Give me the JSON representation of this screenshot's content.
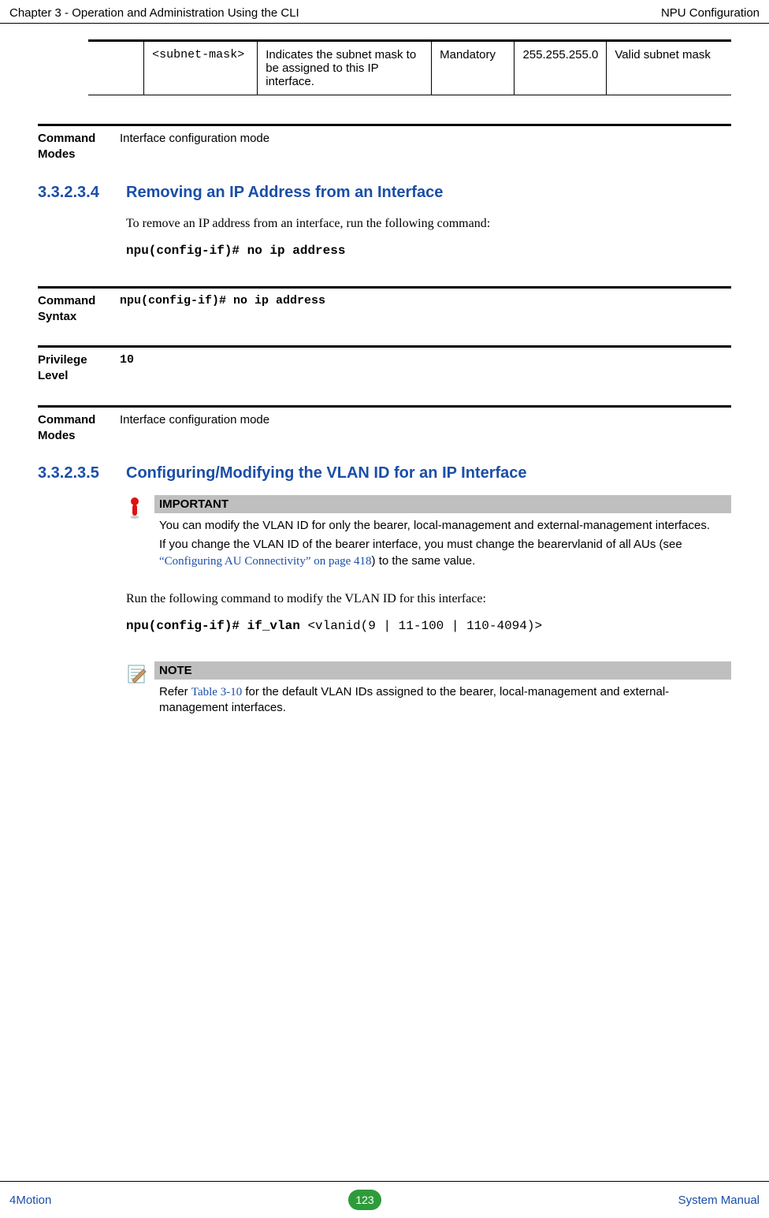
{
  "header": {
    "left": "Chapter 3 - Operation and Administration Using the CLI",
    "right": "NPU Configuration"
  },
  "param_table": {
    "cells": {
      "p0": "<subnet-mask>",
      "p1": "Indicates the subnet mask to be assigned to this IP interface.",
      "p2": "Mandatory",
      "p3": "255.255.255.0",
      "p4": "Valid subnet mask"
    }
  },
  "def1": {
    "label": "Command Modes",
    "value": "Interface configuration mode"
  },
  "sec1": {
    "num": "3.3.2.3.4",
    "title": "Removing an IP Address from an Interface",
    "body": "To remove an IP address from an interface, run the following command:",
    "cmd": "npu(config-if)# no ip address"
  },
  "def2": {
    "label": "Command Syntax",
    "value": "npu(config-if)# no ip address"
  },
  "def3": {
    "label": "Privilege Level",
    "value": "10"
  },
  "def4": {
    "label": "Command Modes",
    "value": "Interface configuration mode"
  },
  "sec2": {
    "num": "3.3.2.3.5",
    "title": "Configuring/Modifying the VLAN ID for an IP Interface"
  },
  "important": {
    "head": "IMPORTANT",
    "text1": "You can modify the VLAN ID for only the bearer, local-management and external-management interfaces.",
    "text2a": "If you change the VLAN ID of the bearer interface, you must change the bearervlanid of all AUs (see ",
    "text2link": "“Configuring AU Connectivity” on page 418",
    "text2b": ") to the same value."
  },
  "runtext": "Run the following command to modify the VLAN ID for this interface:",
  "cmd2a": "npu(config-if)# if_vlan ",
  "cmd2b": "<vlanid(9 | 11-100 | 110-4094)>",
  "note": {
    "head": "NOTE",
    "text_a": "Refer ",
    "text_link": "Table 3-10",
    "text_b": " for the default VLAN IDs assigned to the bearer, local-management and external-management interfaces."
  },
  "footer": {
    "left": "4Motion",
    "page": "123",
    "right": "System Manual"
  },
  "chart_data": null
}
